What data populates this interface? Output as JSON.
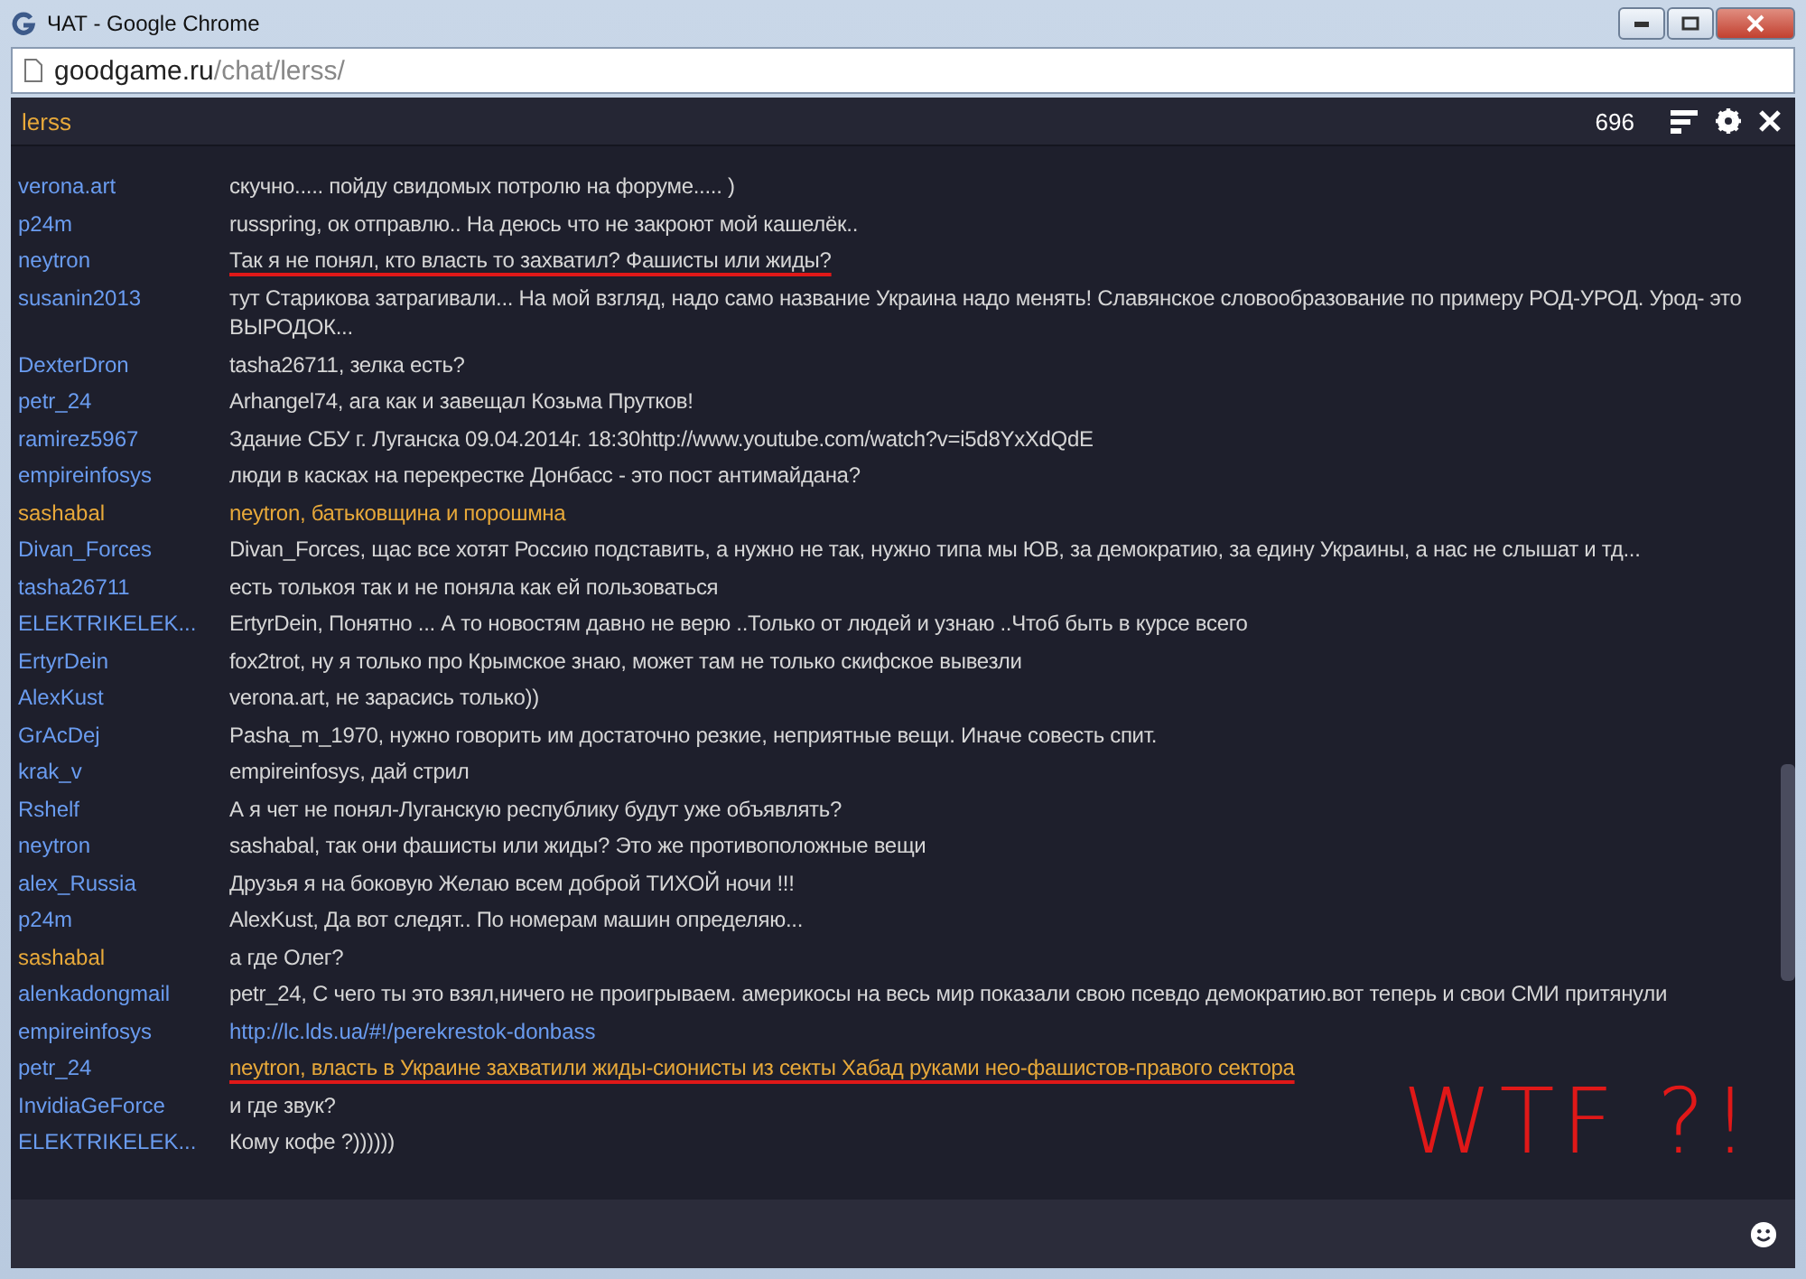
{
  "window": {
    "title": "ЧАТ - Google Chrome",
    "url_host": "goodgame.ru",
    "url_path": "/chat/lerss/"
  },
  "chat_header": {
    "channel": "lerss",
    "viewers": "696"
  },
  "messages": [
    {
      "user": "verona.art",
      "color": "#6a9cf0",
      "text": "скучно..... пойду свидомых потролю на форуме..... )",
      "kind": "text",
      "highlighted": false,
      "underlined": false
    },
    {
      "user": "p24m",
      "color": "#6a9cf0",
      "text": "russpring, ок отправлю.. На деюсь что не закроют мой кашелёк..",
      "kind": "text",
      "highlighted": false,
      "underlined": false
    },
    {
      "user": "neytron",
      "color": "#6a9cf0",
      "text": "Так я не понял, кто власть то захватил? Фашисты или жиды?",
      "kind": "text",
      "highlighted": false,
      "underlined": true
    },
    {
      "user": "susanin2013",
      "color": "#6a9cf0",
      "text": "тут Старикова затрагивали... На мой взгляд, надо само название Украина надо менять! Славянское словообразование по примеру РОД-УРОД. Урод- это ВЫРОДОК...",
      "kind": "text",
      "highlighted": false,
      "underlined": false
    },
    {
      "user": "DexterDron",
      "color": "#6a9cf0",
      "text": "tasha26711, зелка есть?",
      "kind": "text",
      "highlighted": false,
      "underlined": false
    },
    {
      "user": "petr_24",
      "color": "#6a9cf0",
      "text": "Arhangel74, ага как и завещал Козьма Прутков!",
      "kind": "text",
      "highlighted": false,
      "underlined": false
    },
    {
      "user": "ramirez5967",
      "color": "#6a9cf0",
      "text": "Здание СБУ г. Луганска 09.04.2014г. 18:30http://www.youtube.com/watch?v=i5d8YxXdQdE",
      "kind": "text",
      "highlighted": false,
      "underlined": false
    },
    {
      "user": "empireinfosys",
      "color": "#6a9cf0",
      "text": "люди в касках на перекрестке Донбасс - это пост антимайдана?",
      "kind": "text",
      "highlighted": false,
      "underlined": false
    },
    {
      "user": "sashabal",
      "color": "#e8a93a",
      "text": "neytron, батьковщина и порошмна",
      "kind": "text",
      "highlighted": true,
      "underlined": false
    },
    {
      "user": "Divan_Forces",
      "color": "#6a9cf0",
      "text": "Divan_Forces, щас все хотят Россию подставить, а нужно не так, нужно типа мы ЮВ, за демократию, за едину Украины, а нас не слышат и тд...",
      "kind": "text",
      "highlighted": false,
      "underlined": false
    },
    {
      "user": "tasha26711",
      "color": "#6a9cf0",
      "text": "есть толькоя так и не поняла как ей пользоваться",
      "kind": "text",
      "highlighted": false,
      "underlined": false
    },
    {
      "user": "ELEKTRIKELEK...",
      "color": "#6a9cf0",
      "text": "ErtyrDein, Понятно ... А то новостям давно не верю ..Только от людей и узнаю ..Чтоб быть в курсе всего",
      "kind": "text",
      "highlighted": false,
      "underlined": false
    },
    {
      "user": "ErtyrDein",
      "color": "#6a9cf0",
      "text": "fox2trot, ну я только про Крымское знаю, может там не только скифское вывезли",
      "kind": "text",
      "highlighted": false,
      "underlined": false
    },
    {
      "user": "AlexKust",
      "color": "#6a9cf0",
      "text": "verona.art, не зарасись только))",
      "kind": "text",
      "highlighted": false,
      "underlined": false
    },
    {
      "user": "GrAcDej",
      "color": "#6a9cf0",
      "text": "Pasha_m_1970, нужно говорить им достаточно резкие, неприятные вещи. Иначе совесть спит.",
      "kind": "text",
      "highlighted": false,
      "underlined": false
    },
    {
      "user": "krak_v",
      "color": "#6a9cf0",
      "text": "empireinfosys, дай стрил",
      "kind": "text",
      "highlighted": false,
      "underlined": false
    },
    {
      "user": "Rshelf",
      "color": "#6a9cf0",
      "text": "А я чет не понял-Луганскую республику будут уже объявлять?",
      "kind": "text",
      "highlighted": false,
      "underlined": false
    },
    {
      "user": "neytron",
      "color": "#6a9cf0",
      "text": "sashabal, так они фашисты или жиды? Это же противоположные вещи",
      "kind": "text",
      "highlighted": false,
      "underlined": false
    },
    {
      "user": "alex_Russia",
      "color": "#6a9cf0",
      "text": "Друзья я на боковую Желаю всем доброй ТИХОЙ ночи !!!",
      "kind": "text",
      "highlighted": false,
      "underlined": false
    },
    {
      "user": "p24m",
      "color": "#6a9cf0",
      "text": "AlexKust, Да вот следят.. По номерам машин определяю...",
      "kind": "text",
      "highlighted": false,
      "underlined": false
    },
    {
      "user": "sashabal",
      "color": "#e8a93a",
      "text": "а где Олег?",
      "kind": "text",
      "highlighted": false,
      "underlined": false
    },
    {
      "user": "alenkadongmail",
      "color": "#6a9cf0",
      "text": "petr_24, С чего ты это взял,ничего не проигрываем. америкосы на весь мир показали свою псевдо демократию.вот теперь и свои СМИ притянули",
      "kind": "text",
      "highlighted": false,
      "underlined": false
    },
    {
      "user": "empireinfosys",
      "color": "#6a9cf0",
      "text": "http://lc.lds.ua/#!/perekrestok-donbass",
      "kind": "link",
      "highlighted": false,
      "underlined": false
    },
    {
      "user": "petr_24",
      "color": "#6a9cf0",
      "text": "neytron, власть в Украине захватили жиды-сионисты из секты Хабад руками нео-фашистов-правого сектора",
      "kind": "text",
      "highlighted": true,
      "underlined": true
    },
    {
      "user": "InvidiaGeForce",
      "color": "#6a9cf0",
      "text": "и где звук?",
      "kind": "text",
      "highlighted": false,
      "underlined": false
    },
    {
      "user": "ELEKTRIKELEK...",
      "color": "#6a9cf0",
      "text": "Кому кофе ?))))))",
      "kind": "text",
      "highlighted": false,
      "underlined": false
    }
  ],
  "annotation": "WTF ?!"
}
